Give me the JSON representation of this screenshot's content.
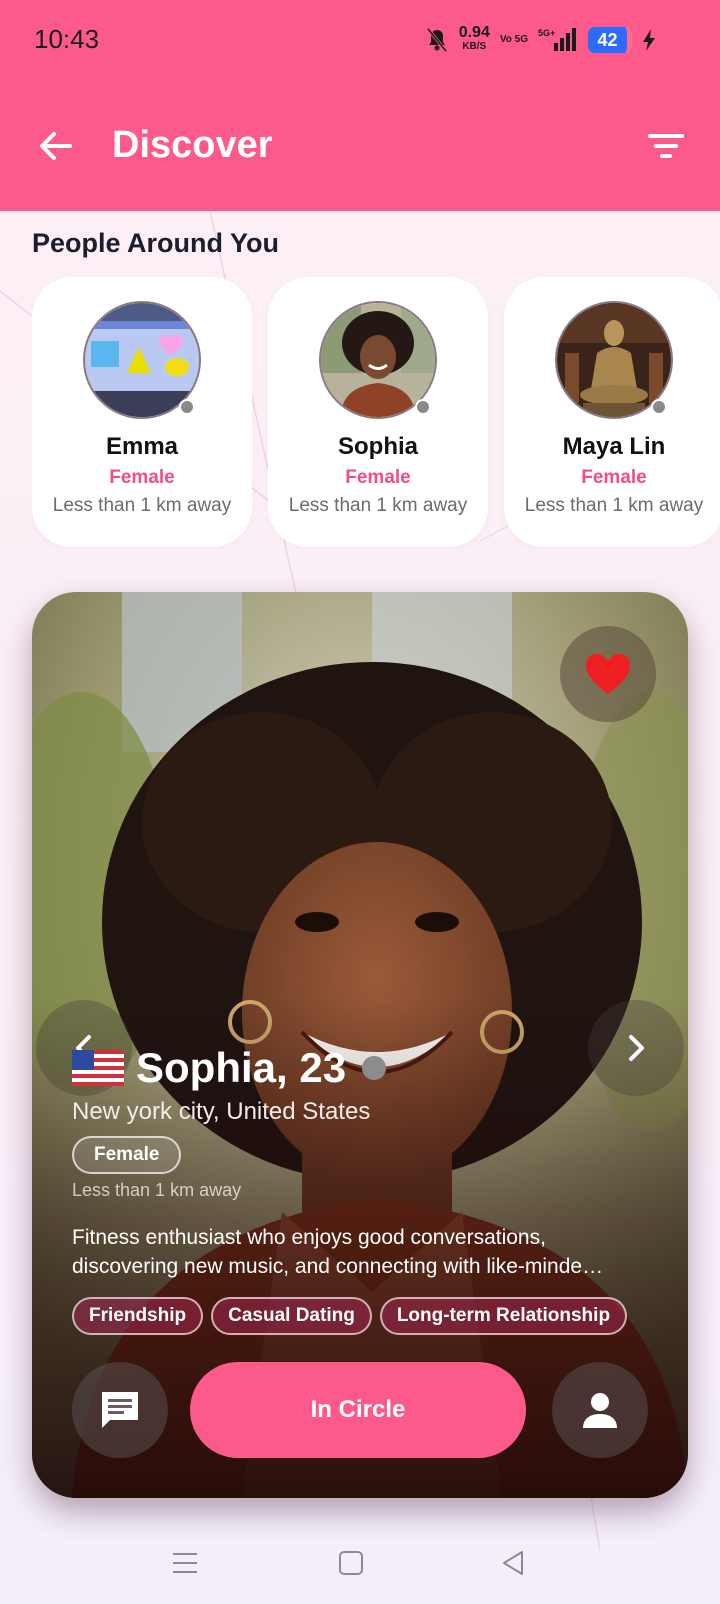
{
  "status_bar": {
    "time": "10:43",
    "net_speed": "0.94",
    "net_unit": "KB/S",
    "volte": "Vo 5G",
    "signal": "5G+",
    "battery": "42"
  },
  "app_bar": {
    "title": "Discover",
    "back_icon": "arrow-left-icon",
    "filter_icon": "filter-icon"
  },
  "people_section": {
    "title": "People Around You",
    "people": [
      {
        "name": "Emma",
        "gender": "Female",
        "distance": "Less than 1 km away"
      },
      {
        "name": "Sophia",
        "gender": "Female",
        "distance": "Less than 1 km away"
      },
      {
        "name": "Maya Lin",
        "gender": "Female",
        "distance": "Less than 1 km away"
      }
    ]
  },
  "profile_card": {
    "name_age": "Sophia, 23",
    "flag": "us-flag-icon",
    "location": "New york city, United States",
    "gender": "Female",
    "distance": "Less than 1 km away",
    "bio": "Fitness enthusiast who enjoys good conversations, discovering new music, and connecting with like-minde…",
    "bio_line1": "Fitness enthusiast who enjoys good conversations,",
    "bio_line2": "discovering new music, and connecting with like-minde…",
    "tags": [
      "Friendship",
      "Casual Dating",
      "Long-term Relationship"
    ],
    "primary_action": "In Circle"
  },
  "colors": {
    "brand": "#fd5a8c",
    "accent_text": "#ef4e8b",
    "heart": "#f01f1f"
  }
}
